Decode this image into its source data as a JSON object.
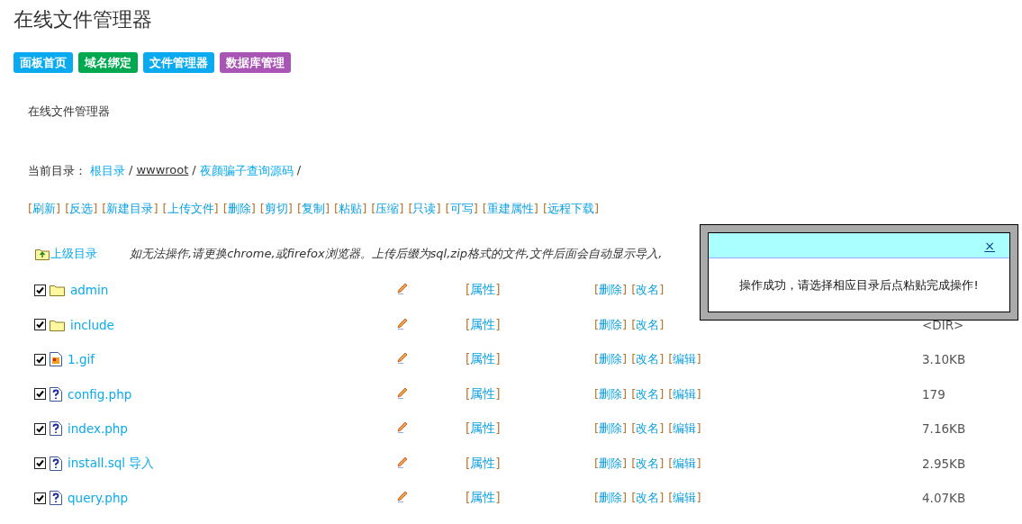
{
  "title": "在线文件管理器",
  "nav": [
    {
      "label": "面板首页",
      "color": "#0aaaf0"
    },
    {
      "label": "域名绑定",
      "color": "#00a94f"
    },
    {
      "label": "文件管理器",
      "color": "#0aaaf0"
    },
    {
      "label": "数据库管理",
      "color": "#a855b5"
    }
  ],
  "subtitle": "在线文件管理器",
  "breadcrumb": {
    "label": "当前目录：",
    "items": [
      {
        "text": "根目录",
        "hovered": false
      },
      {
        "text": "wwwroot",
        "hovered": true
      },
      {
        "text": "夜颜骗子查询源码",
        "hovered": false
      }
    ],
    "separator": "/"
  },
  "toolbar": [
    "[刷新]",
    "[反选]",
    "[新建目录]",
    "[上传文件]",
    "[删除]",
    "[剪切]",
    "[复制]",
    "[粘贴]",
    "[压缩]",
    "[只读]",
    "[可写]",
    "[重建属性]",
    "[远程下载]"
  ],
  "parent": {
    "label": "上级目录",
    "hint": "如无法操作,请更换chrome,或firefox浏览器。上传后缀为sql,zip格式的文件,文件后面会自动显示导入,"
  },
  "files": [
    {
      "kind": "folder",
      "name": "admin",
      "checked": true,
      "props": "[属性]",
      "actions": [
        "[删除]",
        "[改名]"
      ]
    },
    {
      "kind": "folder",
      "name": "include",
      "checked": true,
      "props": "[属性]",
      "actions": [
        "[删除]",
        "[改名]"
      ],
      "size": "<DIR>"
    },
    {
      "kind": "image",
      "name": "1.gif",
      "checked": true,
      "props": "[属性]",
      "actions": [
        "[删除]",
        "[改名]",
        "[编辑]"
      ],
      "size": "3.10KB"
    },
    {
      "kind": "unknown",
      "name": "config.php",
      "checked": true,
      "props": "[属性]",
      "actions": [
        "[删除]",
        "[改名]",
        "[编辑]"
      ],
      "size": "179"
    },
    {
      "kind": "unknown",
      "name": "index.php",
      "checked": true,
      "props": "[属性]",
      "actions": [
        "[删除]",
        "[改名]",
        "[编辑]"
      ],
      "size": "7.16KB"
    },
    {
      "kind": "unknown",
      "name": "install.sql 导入",
      "checked": true,
      "props": "[属性]",
      "actions": [
        "[删除]",
        "[改名]",
        "[编辑]"
      ],
      "size": "2.95KB"
    },
    {
      "kind": "unknown",
      "name": "query.php",
      "checked": true,
      "props": "[属性]",
      "actions": [
        "[删除]",
        "[改名]",
        "[编辑]"
      ],
      "size": "4.07KB"
    }
  ],
  "dialog": {
    "close": "×",
    "message": "操作成功，请选择相应目录后点粘贴完成操作!"
  }
}
